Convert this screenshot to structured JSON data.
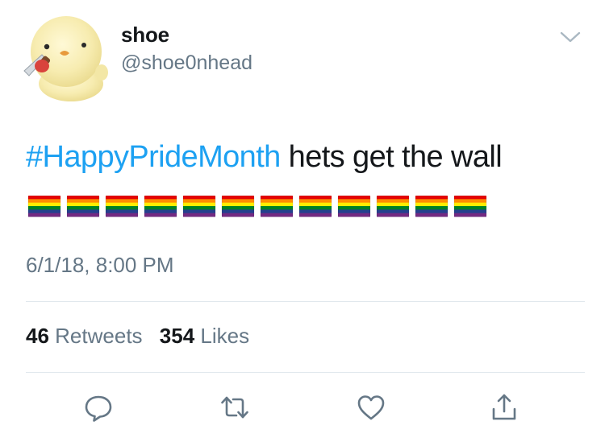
{
  "user": {
    "display_name": "shoe",
    "handle": "@shoe0nhead",
    "avatar_icon": "duckling-with-knife-avatar"
  },
  "tweet": {
    "hashtag": "#HappyPrideMonth",
    "text": " hets get the wall",
    "flag_icon": "rainbow-flag-icon",
    "flag_count": 12,
    "timestamp": "6/1/18, 8:00 PM"
  },
  "stats": {
    "retweets_count": "46",
    "retweets_label": "Retweets",
    "likes_count": "354",
    "likes_label": "Likes"
  },
  "actions": [
    {
      "name": "reply",
      "icon": "reply-icon"
    },
    {
      "name": "retweet",
      "icon": "retweet-icon"
    },
    {
      "name": "like",
      "icon": "heart-icon"
    },
    {
      "name": "share",
      "icon": "share-icon"
    }
  ],
  "colors": {
    "link": "#1da1f2",
    "text": "#14171a",
    "muted": "#657786",
    "divider": "#e1e8ed",
    "flag_stripes": [
      "#e40303",
      "#ff8c00",
      "#ffed00",
      "#008026",
      "#24408e",
      "#732982"
    ]
  }
}
